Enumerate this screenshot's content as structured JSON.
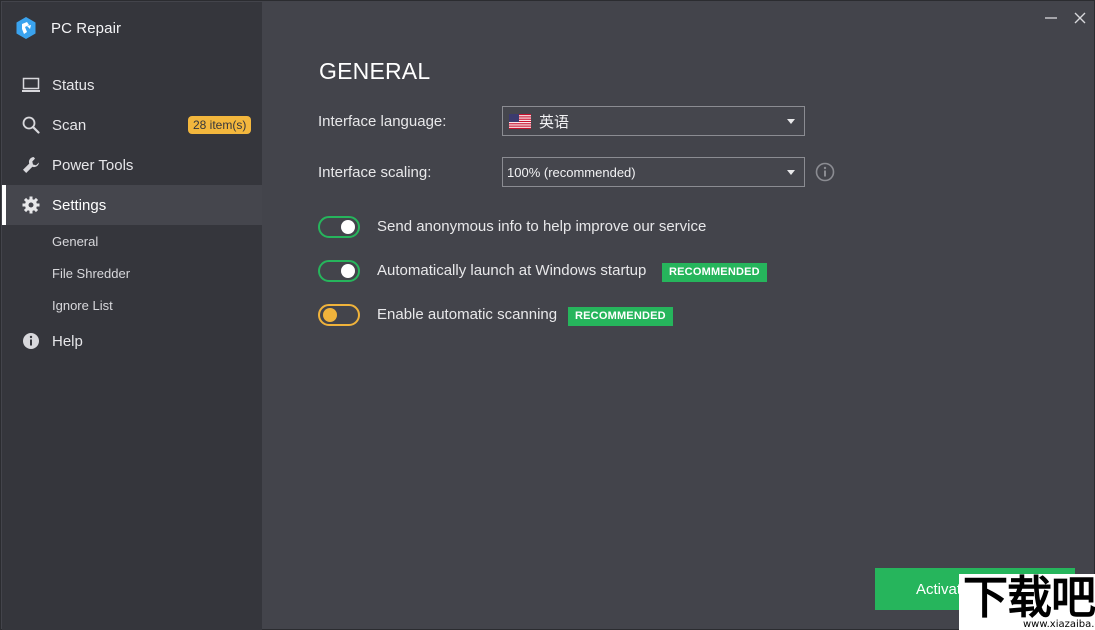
{
  "app": {
    "title": "PC Repair",
    "logo_icon": "pc-repair-logo"
  },
  "colors": {
    "sidebar_bg": "#35363c",
    "main_bg": "#43444b",
    "accent_green": "#26b55c",
    "accent_yellow": "#f3b73d"
  },
  "sidebar": {
    "items": [
      {
        "label": "Status",
        "icon": "monitor-icon"
      },
      {
        "label": "Scan",
        "icon": "search-icon",
        "badge": "28 item(s)"
      },
      {
        "label": "Power Tools",
        "icon": "wrench-icon"
      },
      {
        "label": "Settings",
        "icon": "gear-icon",
        "active": true
      },
      {
        "label": "Help",
        "icon": "info-icon"
      }
    ],
    "settings_subitems": [
      {
        "label": "General"
      },
      {
        "label": "File Shredder"
      },
      {
        "label": "Ignore List"
      }
    ]
  },
  "main": {
    "title": "GENERAL",
    "language": {
      "label": "Interface language:",
      "value": "英语",
      "flag": "us-flag-icon"
    },
    "scaling": {
      "label": "Interface scaling:",
      "value": "100% (recommended)"
    },
    "toggles": [
      {
        "label": "Send anonymous info to help improve our service",
        "state": "on"
      },
      {
        "label": "Automatically launch at Windows startup",
        "state": "on",
        "badge": "RECOMMENDED"
      },
      {
        "label": "Enable automatic scanning",
        "state": "off",
        "badge": "RECOMMENDED"
      }
    ],
    "activate_button": "Activat"
  },
  "watermark": {
    "main": "下载吧",
    "url": "www.xiazaiba.com"
  }
}
